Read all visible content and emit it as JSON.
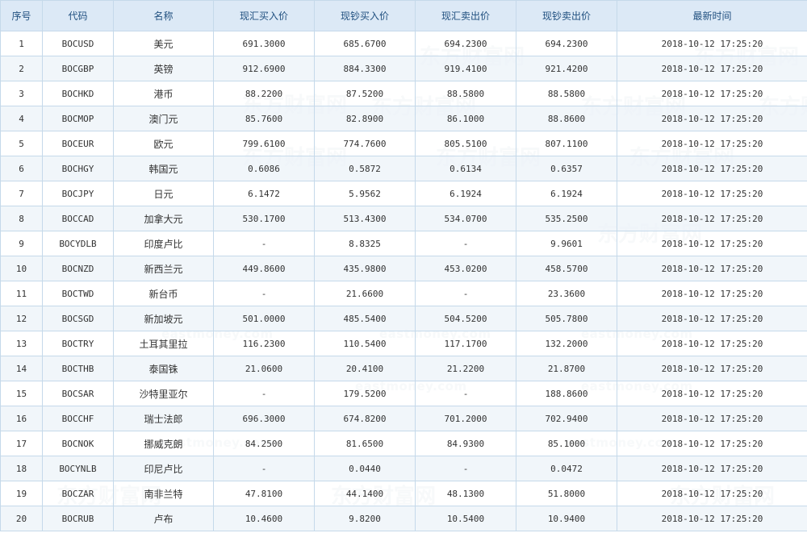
{
  "watermark": {
    "brand_cn": "东方财富网",
    "brand_en": "eastmoney.com"
  },
  "columns": [
    "序号",
    "代码",
    "名称",
    "现汇买入价",
    "现钞买入价",
    "现汇卖出价",
    "现钞卖出价",
    "最新时间"
  ],
  "rows": [
    [
      "1",
      "BOCUSD",
      "美元",
      "691.3000",
      "685.6700",
      "694.2300",
      "694.2300",
      "2018-10-12 17:25:20"
    ],
    [
      "2",
      "BOCGBP",
      "英镑",
      "912.6900",
      "884.3300",
      "919.4100",
      "921.4200",
      "2018-10-12 17:25:20"
    ],
    [
      "3",
      "BOCHKD",
      "港币",
      "88.2200",
      "87.5200",
      "88.5800",
      "88.5800",
      "2018-10-12 17:25:20"
    ],
    [
      "4",
      "BOCMOP",
      "澳门元",
      "85.7600",
      "82.8900",
      "86.1000",
      "88.8600",
      "2018-10-12 17:25:20"
    ],
    [
      "5",
      "BOCEUR",
      "欧元",
      "799.6100",
      "774.7600",
      "805.5100",
      "807.1100",
      "2018-10-12 17:25:20"
    ],
    [
      "6",
      "BOCHGY",
      "韩国元",
      "0.6086",
      "0.5872",
      "0.6134",
      "0.6357",
      "2018-10-12 17:25:20"
    ],
    [
      "7",
      "BOCJPY",
      "日元",
      "6.1472",
      "5.9562",
      "6.1924",
      "6.1924",
      "2018-10-12 17:25:20"
    ],
    [
      "8",
      "BOCCAD",
      "加拿大元",
      "530.1700",
      "513.4300",
      "534.0700",
      "535.2500",
      "2018-10-12 17:25:20"
    ],
    [
      "9",
      "BOCYDLB",
      "印度卢比",
      "-",
      "8.8325",
      "-",
      "9.9601",
      "2018-10-12 17:25:20"
    ],
    [
      "10",
      "BOCNZD",
      "新西兰元",
      "449.8600",
      "435.9800",
      "453.0200",
      "458.5700",
      "2018-10-12 17:25:20"
    ],
    [
      "11",
      "BOCTWD",
      "新台币",
      "-",
      "21.6600",
      "-",
      "23.3600",
      "2018-10-12 17:25:20"
    ],
    [
      "12",
      "BOCSGD",
      "新加坡元",
      "501.0000",
      "485.5400",
      "504.5200",
      "505.7800",
      "2018-10-12 17:25:20"
    ],
    [
      "13",
      "BOCTRY",
      "土耳其里拉",
      "116.2300",
      "110.5400",
      "117.1700",
      "132.2000",
      "2018-10-12 17:25:20"
    ],
    [
      "14",
      "BOCTHB",
      "泰国铢",
      "21.0600",
      "20.4100",
      "21.2200",
      "21.8700",
      "2018-10-12 17:25:20"
    ],
    [
      "15",
      "BOCSAR",
      "沙特里亚尔",
      "-",
      "179.5200",
      "-",
      "188.8600",
      "2018-10-12 17:25:20"
    ],
    [
      "16",
      "BOCCHF",
      "瑞士法郎",
      "696.3000",
      "674.8200",
      "701.2000",
      "702.9400",
      "2018-10-12 17:25:20"
    ],
    [
      "17",
      "BOCNOK",
      "挪威克朗",
      "84.2500",
      "81.6500",
      "84.9300",
      "85.1000",
      "2018-10-12 17:25:20"
    ],
    [
      "18",
      "BOCYNLB",
      "印尼卢比",
      "-",
      "0.0440",
      "-",
      "0.0472",
      "2018-10-12 17:25:20"
    ],
    [
      "19",
      "BOCZAR",
      "南非兰特",
      "47.8100",
      "44.1400",
      "48.1300",
      "51.8000",
      "2018-10-12 17:25:20"
    ],
    [
      "20",
      "BOCRUB",
      "卢布",
      "10.4600",
      "9.8200",
      "10.5400",
      "10.9400",
      "2018-10-12 17:25:20"
    ]
  ]
}
